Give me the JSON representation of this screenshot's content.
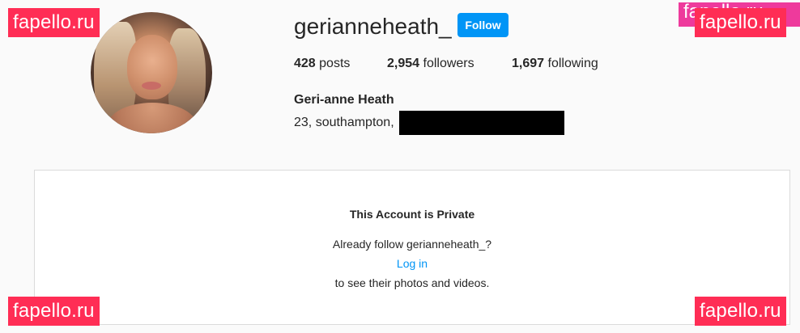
{
  "watermarks": {
    "top_left": "fapello.ru",
    "top_right": "fapello.ru",
    "top_right_partial": "fapello.ru",
    "bottom_left": "fapello.ru",
    "bottom_right": "fapello.ru"
  },
  "profile": {
    "username": "gerianneheath_",
    "follow_label": "Follow",
    "stats": {
      "posts_count": "428",
      "posts_label": "posts",
      "followers_count": "2,954",
      "followers_label": "followers",
      "following_count": "1,697",
      "following_label": "following"
    },
    "full_name": "Geri-anne Heath",
    "bio": "23, southampton,"
  },
  "private": {
    "title": "This Account is Private",
    "already_follow": "Already follow gerianneheath_?",
    "login_label": "Log in",
    "see_text": "to see their photos and videos."
  },
  "colors": {
    "follow_button": "#0095f6",
    "link": "#0095f6",
    "watermark": "#ff2d55",
    "background": "#fafafa"
  }
}
